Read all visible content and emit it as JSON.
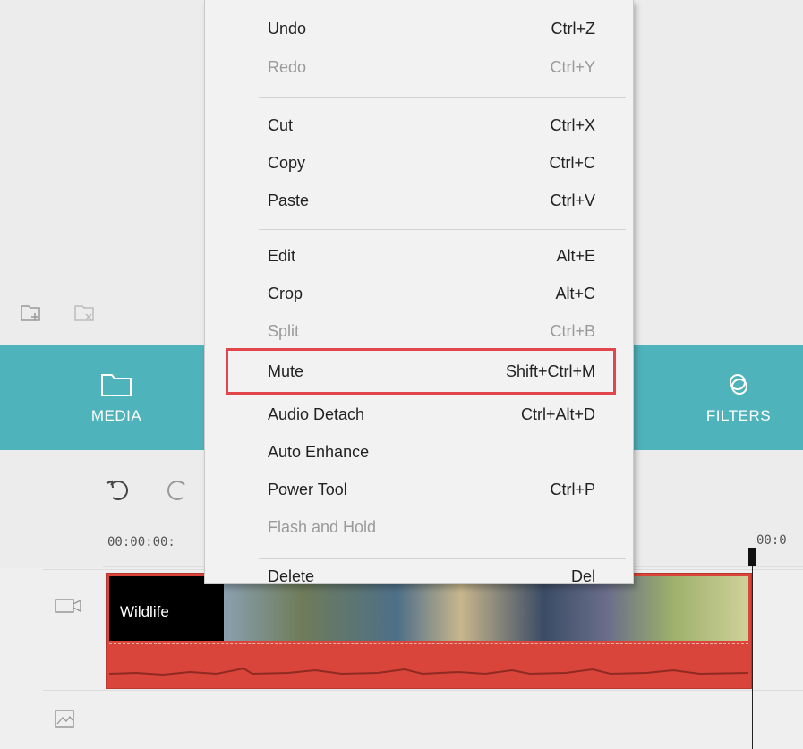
{
  "menu": {
    "items": [
      {
        "label": "Undo",
        "shortcut": "Ctrl+Z",
        "disabled": false
      },
      {
        "label": "Redo",
        "shortcut": "Ctrl+Y",
        "disabled": true
      },
      {
        "label": "Cut",
        "shortcut": "Ctrl+X",
        "disabled": false
      },
      {
        "label": "Copy",
        "shortcut": "Ctrl+C",
        "disabled": false
      },
      {
        "label": "Paste",
        "shortcut": "Ctrl+V",
        "disabled": false
      },
      {
        "label": "Edit",
        "shortcut": "Alt+E",
        "disabled": false
      },
      {
        "label": "Crop",
        "shortcut": "Alt+C",
        "disabled": false
      },
      {
        "label": "Split",
        "shortcut": "Ctrl+B",
        "disabled": true
      },
      {
        "label": "Mute",
        "shortcut": "Shift+Ctrl+M",
        "disabled": false,
        "highlighted": true
      },
      {
        "label": "Audio Detach",
        "shortcut": "Ctrl+Alt+D",
        "disabled": false
      },
      {
        "label": "Auto Enhance",
        "shortcut": "",
        "disabled": false
      },
      {
        "label": "Power Tool",
        "shortcut": "Ctrl+P",
        "disabled": false
      },
      {
        "label": "Flash and Hold",
        "shortcut": "",
        "disabled": true
      },
      {
        "label": "Delete",
        "shortcut": "Del",
        "disabled": false
      }
    ]
  },
  "nav": {
    "media_label": "MEDIA",
    "filters_label": "FILTERS"
  },
  "toolbar": {
    "timecode_left": "00:00:00:",
    "timecode_right": "00:0"
  },
  "timeline": {
    "clip_title": "Wildlife"
  },
  "colors": {
    "nav_bg": "#4fb3bb",
    "clip_red": "#d9453a",
    "highlight": "#e0464c"
  }
}
